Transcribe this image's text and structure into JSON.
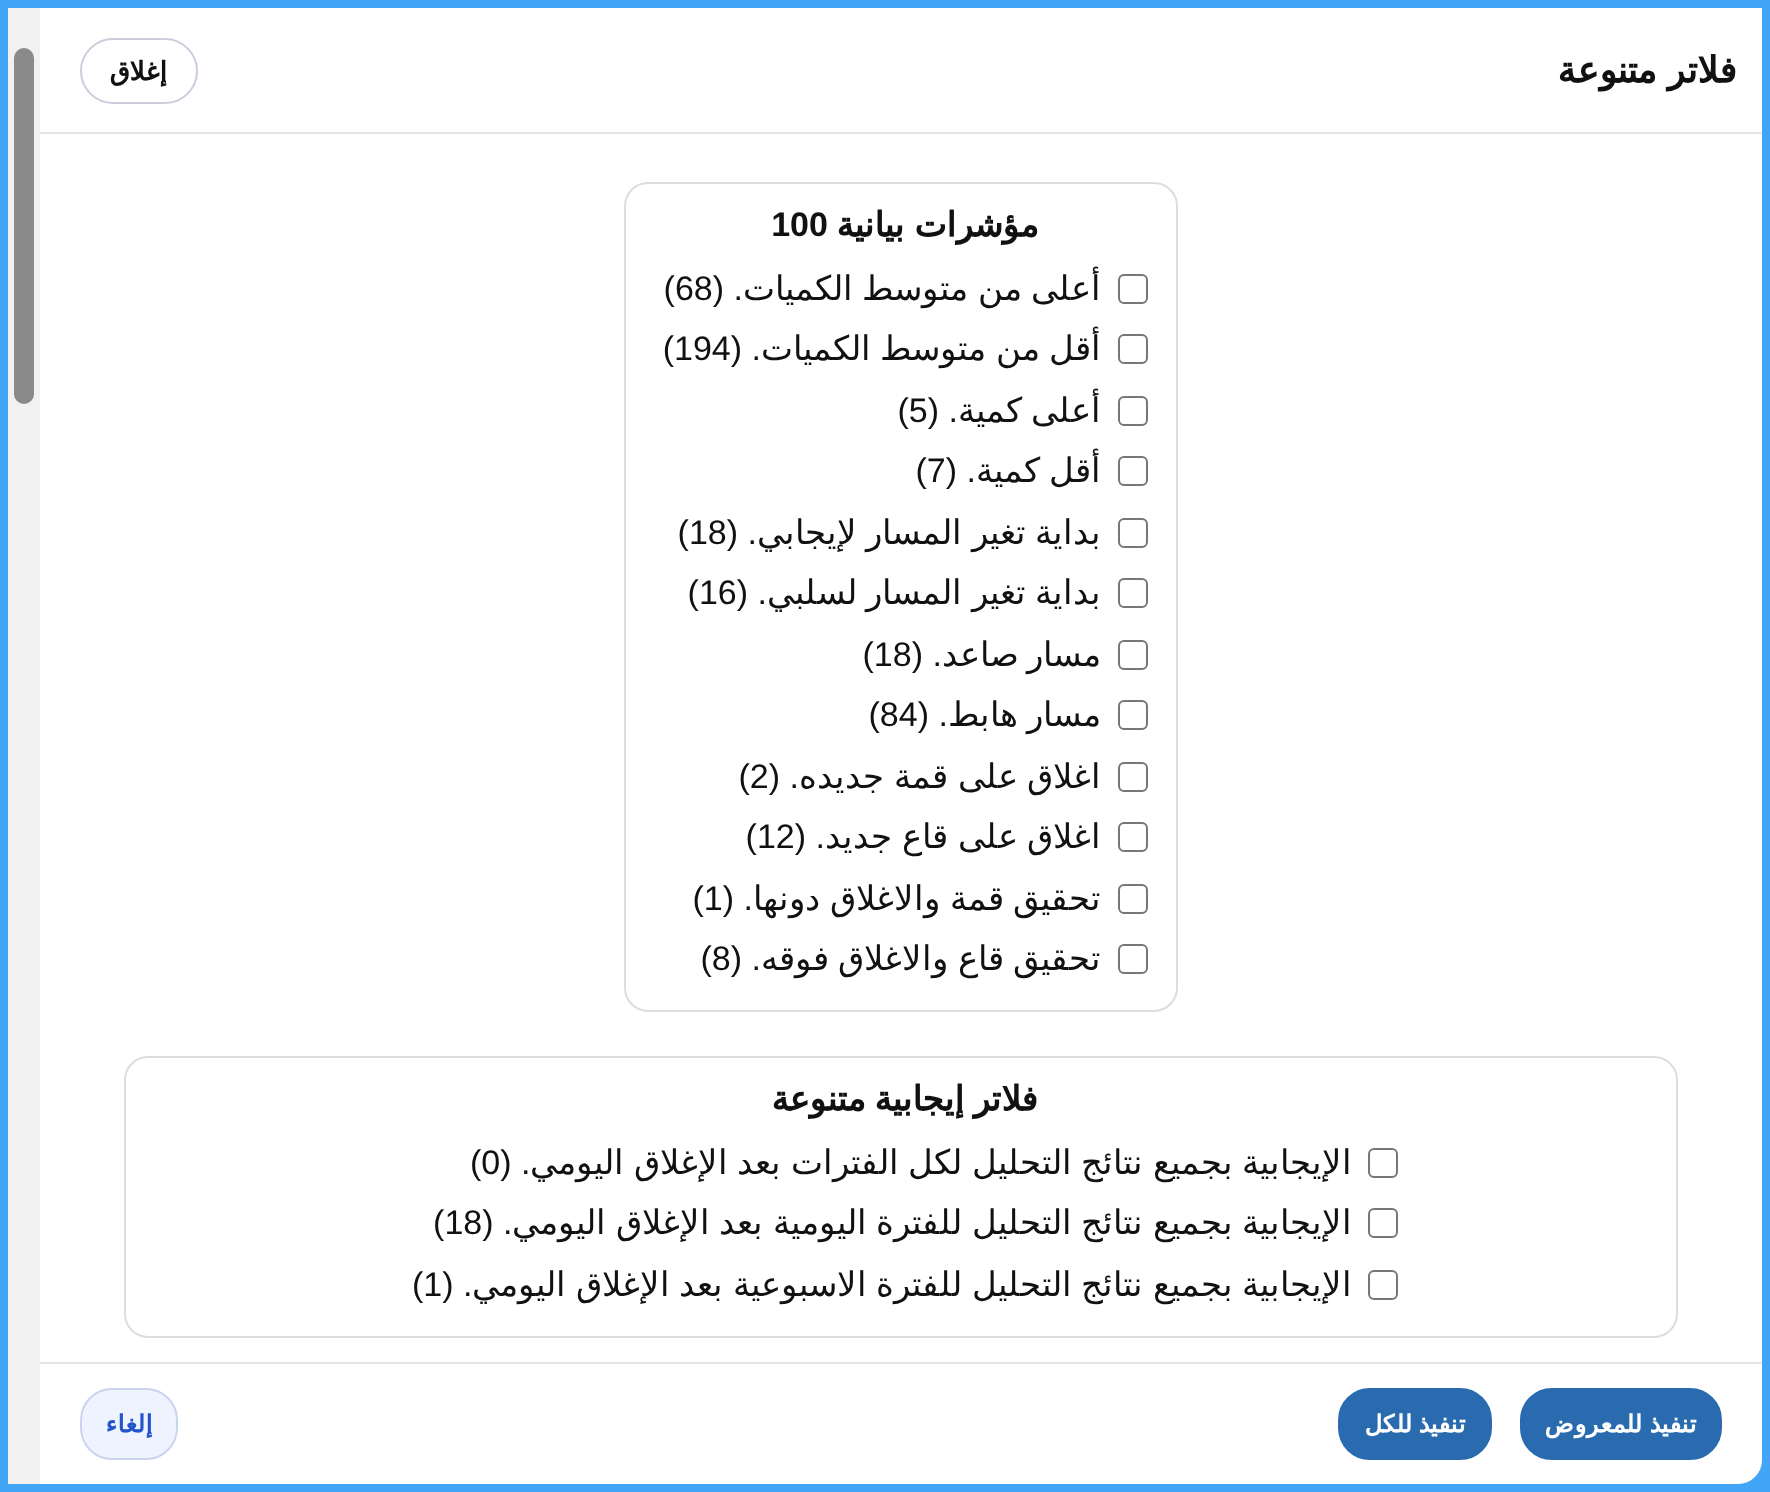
{
  "dialog": {
    "title": "فلاتر متنوعة",
    "close_button": "إغلاق"
  },
  "sections": [
    {
      "title": "مؤشرات بيانية 100",
      "wide": false,
      "items": [
        {
          "label": "أعلى من متوسط الكميات. (68)",
          "checked": false
        },
        {
          "label": "أقل من متوسط الكميات. (194)",
          "checked": false
        },
        {
          "label": "أعلى كمية. (5)",
          "checked": false
        },
        {
          "label": "أقل كمية. (7)",
          "checked": false
        },
        {
          "label": "بداية تغير المسار لإيجابي. (18)",
          "checked": false
        },
        {
          "label": "بداية تغير المسار لسلبي. (16)",
          "checked": false
        },
        {
          "label": "مسار صاعد. (18)",
          "checked": false
        },
        {
          "label": "مسار هابط. (84)",
          "checked": false
        },
        {
          "label": "اغلاق على قمة جديده. (2)",
          "checked": false
        },
        {
          "label": "اغلاق على قاع جديد. (12)",
          "checked": false
        },
        {
          "label": "تحقيق قمة والاغلاق دونها. (1)",
          "checked": false
        },
        {
          "label": "تحقيق قاع والاغلاق فوقه. (8)",
          "checked": false
        }
      ]
    },
    {
      "title": "فلاتر إيجابية متنوعة",
      "wide": true,
      "items": [
        {
          "label": "الإيجابية بجميع نتائج التحليل لكل الفترات بعد الإغلاق اليومي. (0)",
          "checked": false
        },
        {
          "label": "الإيجابية بجميع نتائج التحليل للفترة اليومية بعد الإغلاق اليومي. (18)",
          "checked": false
        },
        {
          "label": "الإيجابية بجميع نتائج التحليل للفترة الاسبوعية بعد الإغلاق اليومي. (1)",
          "checked": false
        }
      ]
    }
  ],
  "footer": {
    "buttons": [
      {
        "label": "تنفيذ للمعروض",
        "kind": "primary"
      },
      {
        "label": "تنفيذ للكل",
        "kind": "primary"
      },
      {
        "label": "إلغاء",
        "kind": "secondary"
      }
    ]
  }
}
